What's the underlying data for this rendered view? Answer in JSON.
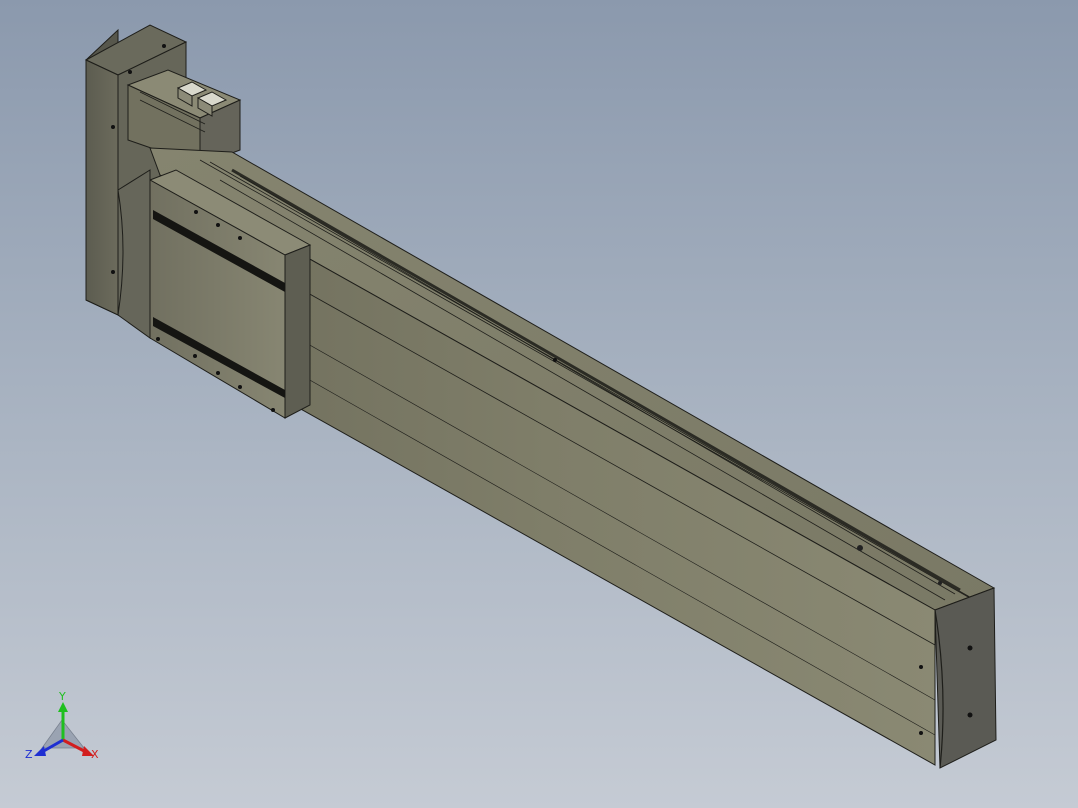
{
  "viewport": {
    "background_top": "#8b99ad",
    "background_bottom": "#c5cbd4"
  },
  "model": {
    "body_color": "#7c7b66",
    "edge_color": "#1e1e1a"
  },
  "triad": {
    "y_label": "Y",
    "z_label": "Z",
    "x_label": "X",
    "y_color": "#1fbf1f",
    "x_color": "#d21e1e",
    "z_color": "#1e2fd2"
  }
}
